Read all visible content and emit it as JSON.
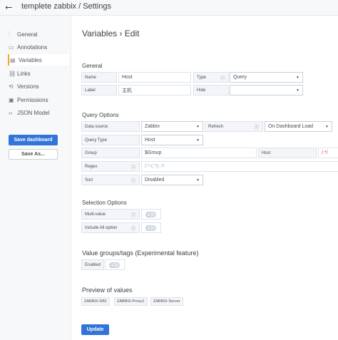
{
  "header": {
    "title": "templete zabbix / Settings",
    "back_icon": "arrow-left-icon"
  },
  "sidebar": {
    "items": [
      {
        "label": "General",
        "icon": "sliders-icon",
        "glyph": "⫶"
      },
      {
        "label": "Annotations",
        "icon": "comment-icon",
        "glyph": "▭"
      },
      {
        "label": "Variables",
        "icon": "variables-icon",
        "glyph": "▤",
        "active": true
      },
      {
        "label": "Links",
        "icon": "link-icon",
        "glyph": "⛓"
      },
      {
        "label": "Versions",
        "icon": "history-icon",
        "glyph": "⟲"
      },
      {
        "label": "Permissions",
        "icon": "lock-icon",
        "glyph": "🔒"
      },
      {
        "label": "JSON Model",
        "icon": "code-icon",
        "glyph": "<>"
      }
    ],
    "save_dashboard": "Save dashboard",
    "save_as": "Save As..."
  },
  "main": {
    "heading": "Variables › Edit",
    "general": {
      "title": "General",
      "name_label": "Name",
      "name_value": "Host",
      "type_label": "Type",
      "type_value": "Query",
      "label_label": "Label",
      "label_value": "主机",
      "hide_label": "Hide",
      "hide_value": ""
    },
    "query_options": {
      "title": "Query Options",
      "datasource_label": "Data source",
      "datasource_value": "Zabbix",
      "refresh_label": "Refresh",
      "refresh_value": "On Dashboard Load",
      "query_type_label": "Query Type",
      "query_type_value": "Host",
      "group_label": "Group",
      "group_value": "$Group",
      "host_label": "Host",
      "host_value": "/.*/",
      "regex_label": "Regex",
      "regex_placeholder": "/.*-(.*)-.*/",
      "sort_label": "Sort",
      "sort_value": "Disabled"
    },
    "selection_options": {
      "title": "Selection Options",
      "multi_value_label": "Multi-value",
      "multi_value": false,
      "include_all_label": "Include All option",
      "include_all": false
    },
    "value_groups": {
      "title": "Value groups/tags (Experimental feature)",
      "enabled_label": "Enabled",
      "enabled": false
    },
    "preview": {
      "title": "Preview of values",
      "values": [
        "ZABBIX-DB1",
        "ZABBIX-Proxy1",
        "ZABBIX-Server"
      ]
    },
    "update_button": "Update"
  },
  "colors": {
    "primary": "#3274d9",
    "active_accent": "#f5a623",
    "error_text": "#e02f44"
  }
}
